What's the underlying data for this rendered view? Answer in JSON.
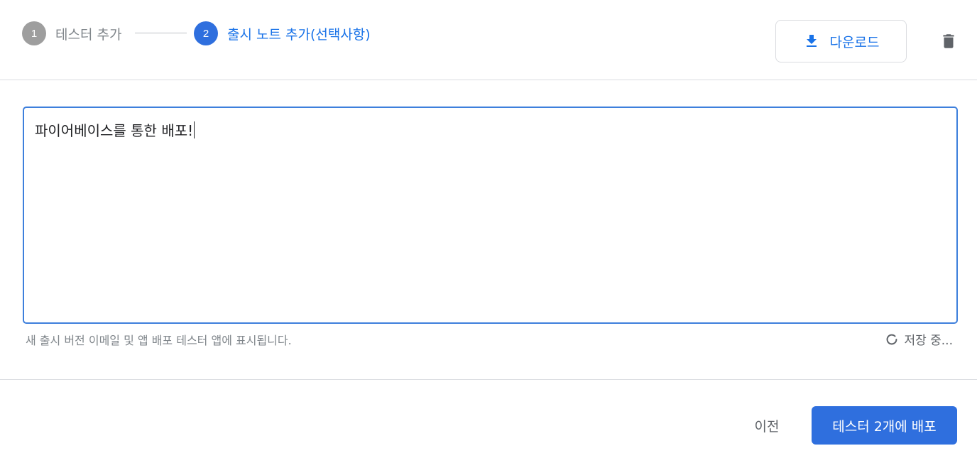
{
  "stepper": {
    "steps": [
      {
        "number": "1",
        "label": "테스터 추가",
        "state": "inactive"
      },
      {
        "number": "2",
        "label": "출시 노트 추가(선택사항)",
        "state": "active"
      }
    ]
  },
  "toolbar": {
    "download_label": "다운로드",
    "download_icon": "download-icon",
    "delete_icon": "trash-icon"
  },
  "notes": {
    "value": "파이어베이스를 통한 배포!",
    "helper": "새 출시 버전 이메일 및 앱 배포 테스터 앱에 표시됩니다.",
    "saving_label": "저장 중..."
  },
  "footer": {
    "prev_label": "이전",
    "deploy_label": "테스터 2개에 배포"
  },
  "colors": {
    "accent": "#1a73e8",
    "primary_button": "#2f6fde",
    "inactive_step": "#9e9e9e",
    "focus_border": "#3d7fdc"
  }
}
